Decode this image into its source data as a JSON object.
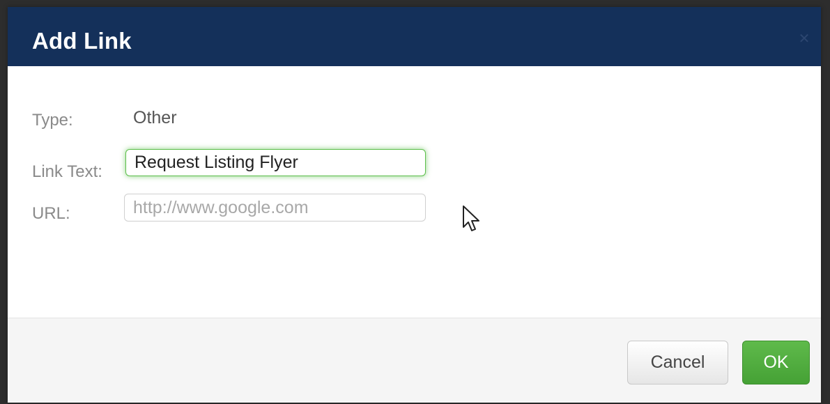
{
  "dialog": {
    "title": "Add Link",
    "close_icon": "close-icon"
  },
  "form": {
    "type_label": "Type:",
    "type_value": "Other",
    "link_text_label": "Link Text:",
    "link_text_value": "Request Listing Flyer",
    "url_label": "URL:",
    "url_placeholder": "http://www.google.com",
    "url_value": ""
  },
  "footer": {
    "cancel_label": "Cancel",
    "ok_label": "OK"
  },
  "colors": {
    "header_bg": "#14305a",
    "ok_button": "#4cae3a",
    "focus_glow": "#5cbf4b"
  }
}
